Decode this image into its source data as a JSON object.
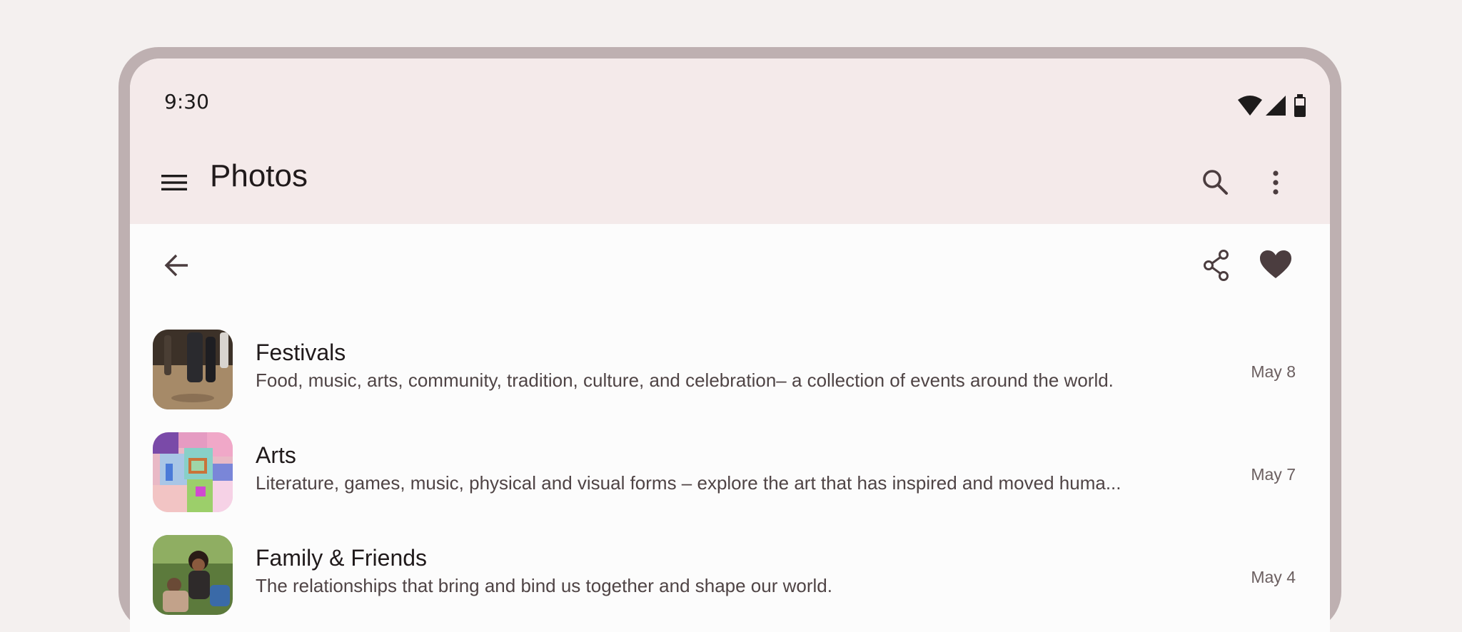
{
  "status_bar": {
    "time": "9:30"
  },
  "app_bar": {
    "title": "Photos",
    "menu_icon": "menu-icon",
    "search_icon": "search-icon",
    "more_icon": "more-vert-icon"
  },
  "sub_toolbar": {
    "back_icon": "arrow-back-icon",
    "share_icon": "share-icon",
    "favorite_icon": "heart-icon"
  },
  "colors": {
    "top_bar": "#f4eaea",
    "frame": "#beb0b1",
    "icon": "#4b3d3f",
    "background": "#f4f0ef"
  },
  "albums": [
    {
      "title": "Festivals",
      "description": "Food, music, arts, community, tradition, culture, and celebration– a collection of events around the world.",
      "date": "May 8"
    },
    {
      "title": "Arts",
      "description": "Literature, games, music, physical and visual forms – explore the art that has inspired and moved huma...",
      "date": "May 7"
    },
    {
      "title": "Family & Friends",
      "description": "The relationships that bring and bind us together and shape our world.",
      "date": "May 4"
    }
  ]
}
